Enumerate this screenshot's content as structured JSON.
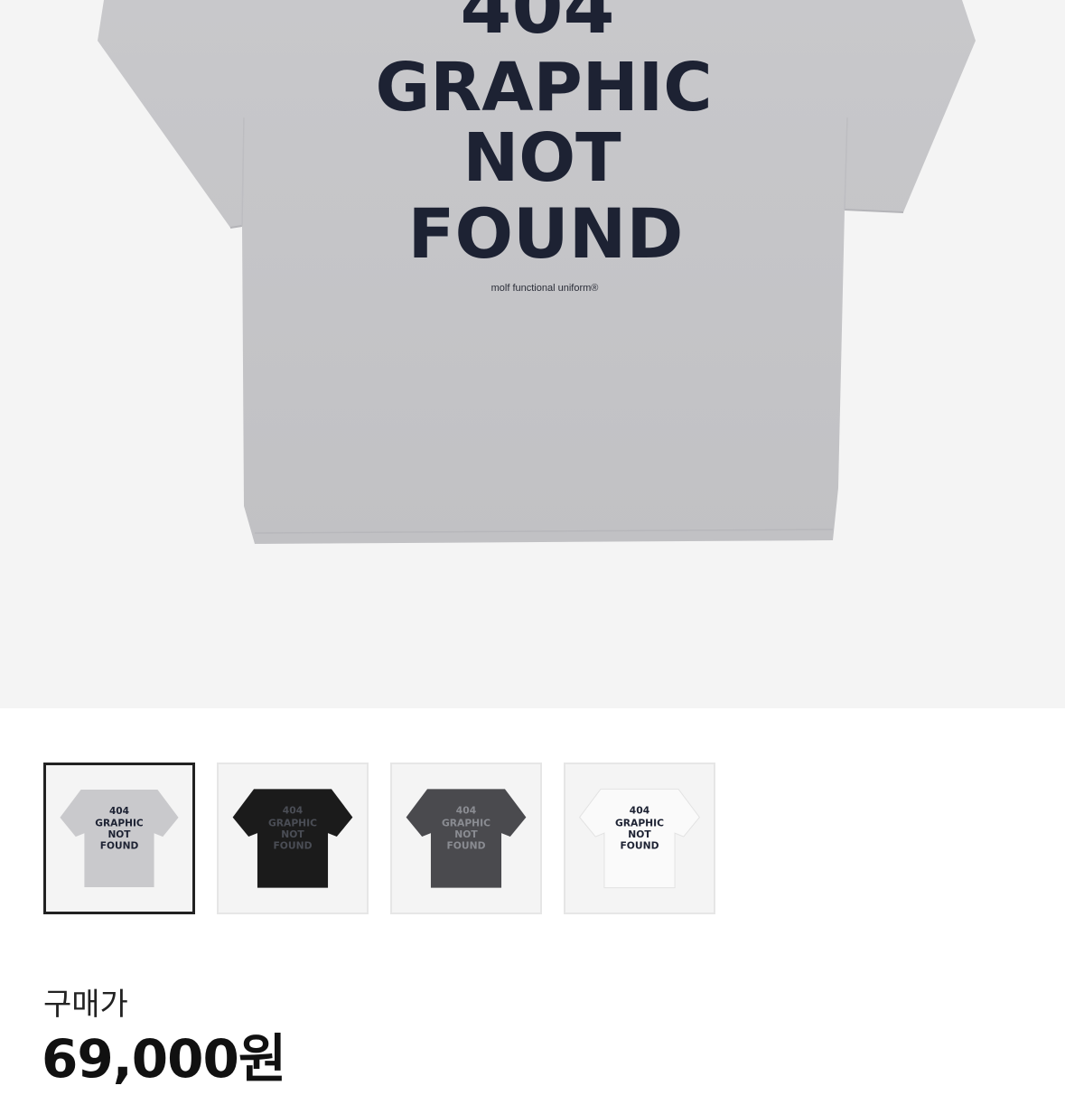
{
  "product": {
    "hero_print": {
      "line1": "404",
      "line2": "GRAPHIC",
      "line3": "NOT",
      "line4": "FOUND",
      "brand": "molf functional uniform®"
    },
    "thumbnails": [
      {
        "color_name": "melange-grey",
        "shirt_color": "#c9c9cc",
        "print_color": "#1d2233",
        "selected": true
      },
      {
        "color_name": "black",
        "shirt_color": "#1b1b1b",
        "print_color": "#4a4d55",
        "selected": false
      },
      {
        "color_name": "charcoal",
        "shirt_color": "#4a4a4e",
        "print_color": "#8a8c92",
        "selected": false
      },
      {
        "color_name": "white",
        "shirt_color": "#fafafa",
        "print_color": "#1d2233",
        "selected": false
      }
    ],
    "price_label": "구매가",
    "price": "69,000원"
  }
}
